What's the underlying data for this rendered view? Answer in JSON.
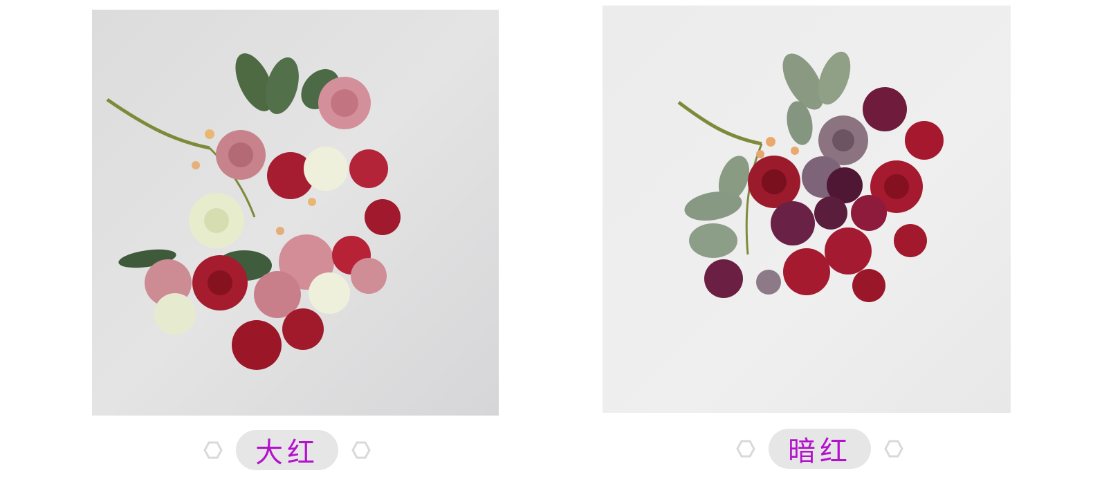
{
  "products": [
    {
      "color_label": "大红",
      "image_alt": "bouquet-bright-red",
      "label_color": "#b312cc"
    },
    {
      "color_label": "暗红",
      "image_alt": "bouquet-dark-red",
      "label_color": "#b312cc"
    }
  ],
  "icons": {
    "left": "hexagon-outline-icon",
    "right": "hexagon-outline-icon"
  }
}
